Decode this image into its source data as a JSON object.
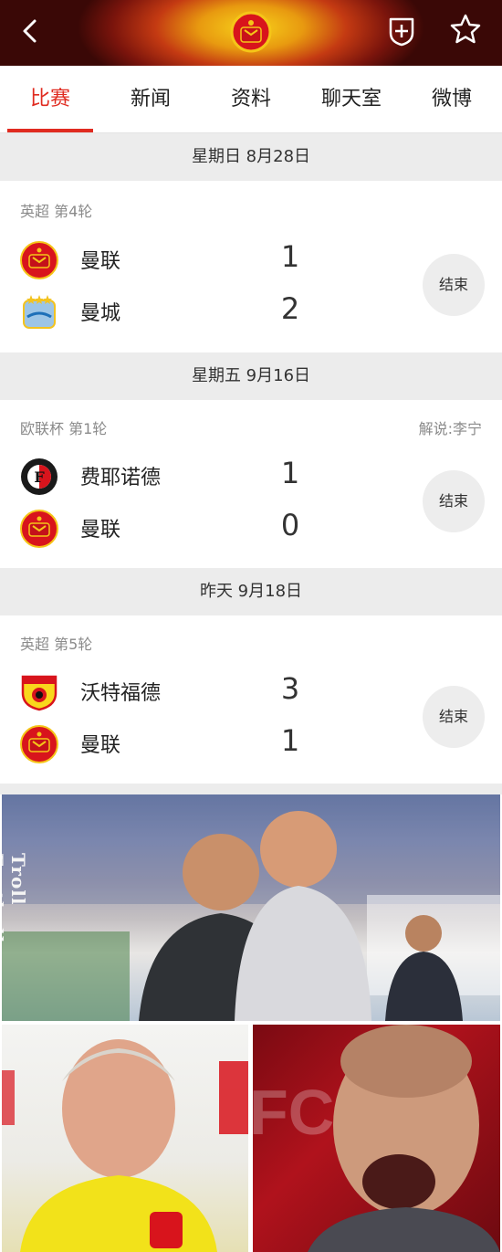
{
  "header": {
    "back_icon": "chevron-left-icon",
    "crest_icon": "manchester-united-crest-icon",
    "follow_icon": "shield-plus-icon",
    "favorite_icon": "star-outline-icon",
    "accent_color": "#e02b20"
  },
  "tabs": [
    {
      "label": "比赛",
      "active": true
    },
    {
      "label": "新闻",
      "active": false
    },
    {
      "label": "资料",
      "active": false
    },
    {
      "label": "聊天室",
      "active": false
    },
    {
      "label": "微博",
      "active": false
    }
  ],
  "matches": [
    {
      "date": "星期日  8月28日",
      "league": "英超 第4轮",
      "commentary": "",
      "home": {
        "name": "曼联",
        "score": "1",
        "logo": "manchester-united-logo"
      },
      "away": {
        "name": "曼城",
        "score": "2",
        "logo": "manchester-city-logo"
      },
      "status": "结束"
    },
    {
      "date": "星期五  9月16日",
      "league": "欧联杯 第1轮",
      "commentary": "解说:李宁",
      "home": {
        "name": "费耶诺德",
        "score": "1",
        "logo": "feyenoord-logo"
      },
      "away": {
        "name": "曼联",
        "score": "0",
        "logo": "manchester-united-logo"
      },
      "status": "结束"
    },
    {
      "date": "昨天  9月18日",
      "league": "英超 第5轮",
      "commentary": "",
      "home": {
        "name": "沃特福德",
        "score": "3",
        "logo": "watford-logo"
      },
      "away": {
        "name": "曼联",
        "score": "1",
        "logo": "manchester-united-logo"
      },
      "status": "结束"
    }
  ],
  "photos": {
    "watermark": "Troll Football",
    "top_caption": "",
    "bottom_left_caption": "",
    "bottom_right_caption": ""
  }
}
